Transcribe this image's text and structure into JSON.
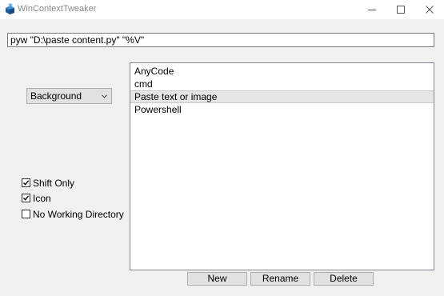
{
  "window": {
    "title": "WinContextTweaker"
  },
  "command": {
    "value": "pyw \"D:\\paste content.py\" \"%V\""
  },
  "context_select": {
    "selected": "Background"
  },
  "entries": [
    {
      "label": "AnyCode",
      "selected": false
    },
    {
      "label": "cmd",
      "selected": false
    },
    {
      "label": "Paste text or image",
      "selected": true
    },
    {
      "label": "Powershell",
      "selected": false
    }
  ],
  "options": [
    {
      "label": "Shift Only",
      "checked": true
    },
    {
      "label": "Icon",
      "checked": true
    },
    {
      "label": "No Working Directory",
      "checked": false
    }
  ],
  "buttons": {
    "new_label": "New",
    "rename_label": "Rename",
    "delete_label": "Delete"
  }
}
